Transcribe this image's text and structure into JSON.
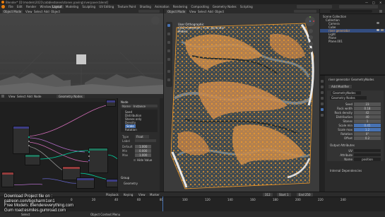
{
  "window": {
    "title": "Blender* [D:\\models\\2021\\cobblestones\\stones paving\\riverpaver.blend]",
    "controls": [
      "—",
      "□",
      "✕"
    ]
  },
  "top_menu": [
    "File",
    "Edit",
    "Render",
    "Window",
    "Help"
  ],
  "workspace_tabs": [
    "Layout",
    "Modeling",
    "Sculpting",
    "UV Editing",
    "Texture Paint",
    "Shading",
    "Animation",
    "Rendering",
    "Compositing",
    "Geometry Nodes",
    "Scripting"
  ],
  "active_workspace": "Layout",
  "left_viewport": {
    "mode": "Object Mode",
    "menu": [
      "View",
      "Select",
      "Add",
      "Object"
    ]
  },
  "node_editor": {
    "menu": [
      "View",
      "Select",
      "Add",
      "Node"
    ],
    "tree_name": "Geometry Nodes",
    "nodes": [
      "Group Input",
      "Mesh Line",
      "Collection Info",
      "Instance on Points",
      "Transform",
      "Join Geometry",
      "Group Output",
      "Realize Instances"
    ]
  },
  "n_panel": {
    "section": "Node",
    "name_label": "Name",
    "name_value": "Instance",
    "label_label": "Label",
    "items": [
      "Seed",
      "Distribution",
      "Stones only",
      "Density",
      "Scale",
      "Rotation"
    ],
    "type_label": "Type",
    "type_value": "Float",
    "value_rows": [
      {
        "label": "Default",
        "value": "1.000"
      },
      {
        "label": "Min",
        "value": "0.000"
      },
      {
        "label": "Max",
        "value": "1.000"
      }
    ],
    "hide_value": "Hide Value",
    "group_header": "Group",
    "outputs": [
      "Geometry"
    ]
  },
  "right_viewport": {
    "mode": "Object Mode",
    "menu": [
      "View",
      "Select",
      "Add",
      "Object"
    ],
    "info_lines": [
      "User Orthographic",
      "(312) Collection | river generator",
      "Meters"
    ],
    "tool_icons": [
      "cursor-icon",
      "move-icon",
      "rotate-icon",
      "scale-icon",
      "transform-icon",
      "annotate-icon",
      "measure-icon"
    ],
    "nav_icons": [
      "axis-gizmo-icon",
      "zoom-icon",
      "hand-icon",
      "camera-icon",
      "ortho-icon"
    ]
  },
  "outliner": {
    "header": "Scene Collection",
    "items": [
      {
        "label": "Collection",
        "icon": "collection-icon"
      },
      {
        "label": "Camera",
        "icon": "camera-icon"
      },
      {
        "label": "Cube",
        "icon": "mesh-icon"
      },
      {
        "label": "river generator",
        "icon": "mesh-icon"
      },
      {
        "label": "Light",
        "icon": "light-icon"
      },
      {
        "label": "Plane",
        "icon": "mesh-icon"
      },
      {
        "label": "Plane.001",
        "icon": "mesh-icon"
      }
    ],
    "selected_index": 3
  },
  "properties": {
    "breadcrumb": [
      "river generator",
      "GeometryNodes"
    ],
    "add_modifier": "Add Modifier",
    "modifier_name": "GeometryNodes",
    "node_group": "Geometry Nodes",
    "inputs": [
      {
        "label": "Seed",
        "value": "23"
      },
      {
        "label": "Rock width",
        "value": "0.18"
      },
      {
        "label": "Rock density",
        "value": "42"
      },
      {
        "label": "Distribution",
        "value": "40"
      },
      {
        "label": "Stones",
        "value": "1"
      },
      {
        "label": "Scale min",
        "value": "0.45"
      },
      {
        "label": "Scale max",
        "value": "1.2"
      },
      {
        "label": "Rotation",
        "value": "0°"
      },
      {
        "label": "Offset",
        "value": "0.2"
      }
    ],
    "output_section": "Output Attributes",
    "output_rows": [
      {
        "label": "UV",
        "value": ""
      },
      {
        "label": "Attribute",
        "value": ""
      },
      {
        "label": "Name",
        "value": "position"
      }
    ],
    "internal_section": "Internal Dependencies"
  },
  "timeline": {
    "menu": [
      "Playback",
      "Keying",
      "View",
      "Marker"
    ],
    "ticks": [
      "0",
      "20",
      "40",
      "60",
      "80",
      "100",
      "120",
      "140",
      "160",
      "180",
      "200",
      "220",
      "240"
    ],
    "current_frame": "312",
    "start": "Start 1",
    "end": "End 250"
  },
  "status_bar": {
    "left": "Select",
    "middle": "Object Context Menu"
  },
  "overlay_text": [
    "Download Project file on :",
    "patreon.com/bgcharm1on1",
    "Free Models: Blendereverything.com",
    "Gum road:esmiles.gumroad.com"
  ],
  "colors": {
    "background": "#1d1d1d",
    "header": "#2b2b2b",
    "selection_orange": "#f29b2a",
    "highlight_blue": "#4772b3",
    "geometry_socket": "#00d6a3",
    "float_socket": "#a1a1a1",
    "vector_socket": "#6363c7"
  }
}
